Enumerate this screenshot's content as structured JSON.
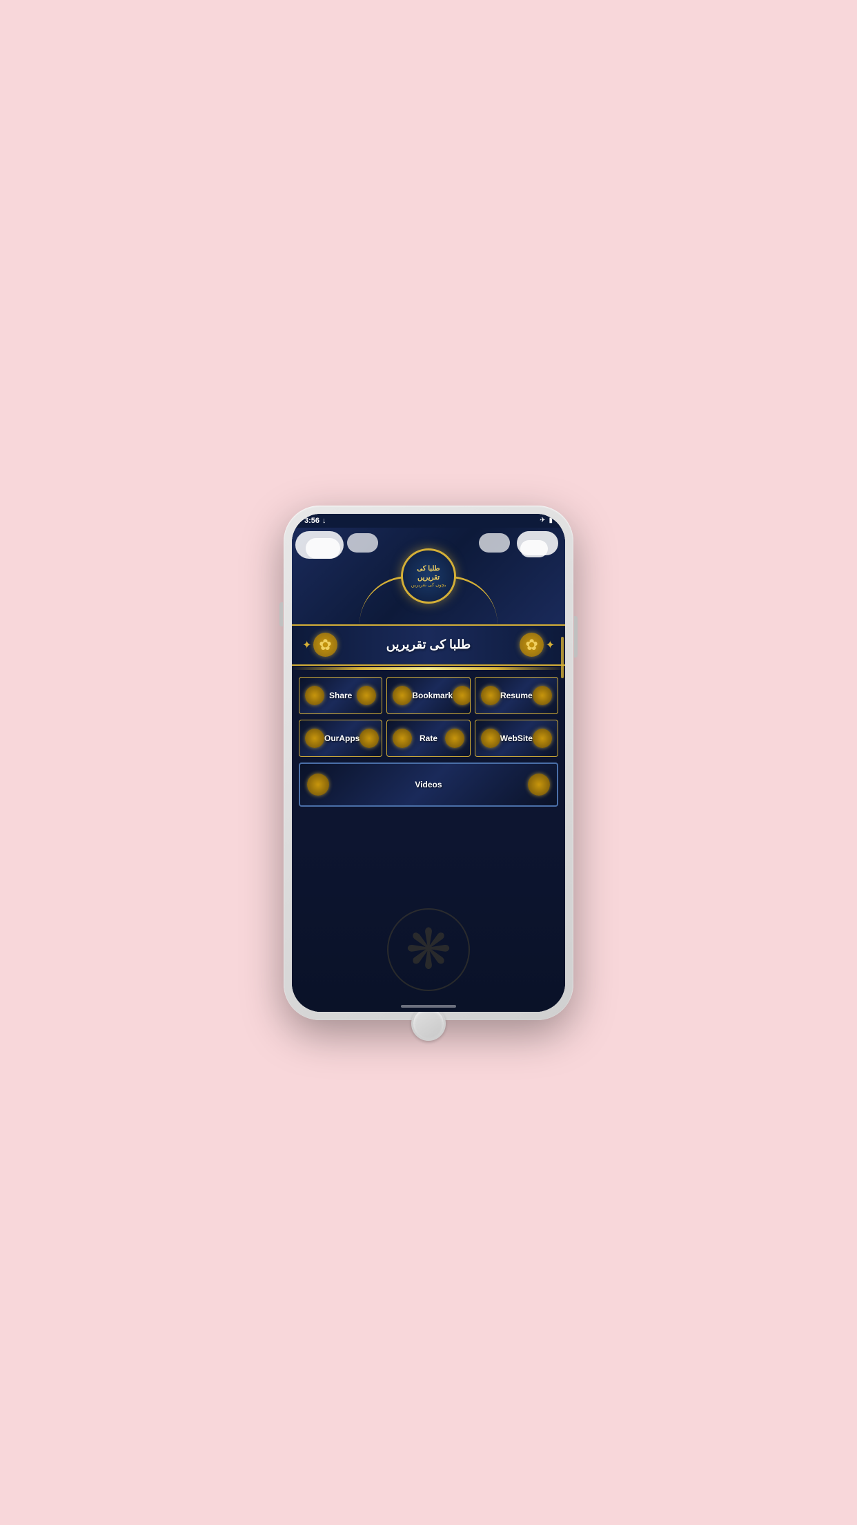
{
  "phone": {
    "status_bar": {
      "time": "3:56",
      "download_icon": "↓",
      "airplane_icon": "✈",
      "battery_icon": "▮"
    },
    "app": {
      "title_urdu": "طلبا کی تقریریں",
      "emblem_line1": "طلبا کی",
      "emblem_line2": "تقریریں",
      "emblem_line3": "بچوں کی تقریریں",
      "buttons": {
        "row1": [
          {
            "label": "Share"
          },
          {
            "label": "Bookmark"
          },
          {
            "label": "Resume"
          }
        ],
        "row2": [
          {
            "label": "OurApps"
          },
          {
            "label": "Rate"
          },
          {
            "label": "WebSite"
          }
        ],
        "row3": [
          {
            "label": "Videos"
          }
        ]
      }
    }
  }
}
